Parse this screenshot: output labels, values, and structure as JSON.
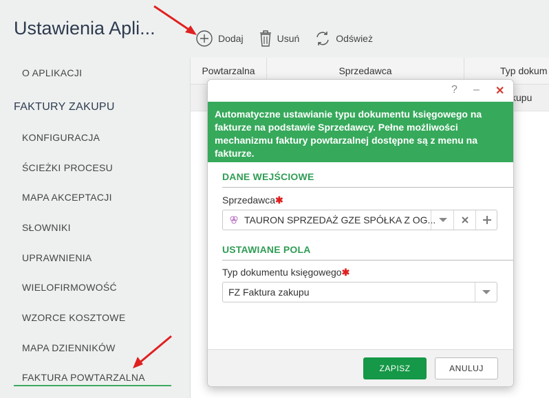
{
  "app": {
    "title": "Ustawienia Apli..."
  },
  "toolbar": {
    "add_label": "Dodaj",
    "delete_label": "Usuń",
    "refresh_label": "Odśwież"
  },
  "sidebar": {
    "about": "O APLIKACJI",
    "section_title": "FAKTURY ZAKUPU",
    "items": [
      {
        "label": "KONFIGURACJA"
      },
      {
        "label": "ŚCIEŻKI PROCESU"
      },
      {
        "label": "MAPA AKCEPTACJI"
      },
      {
        "label": "SŁOWNIKI"
      },
      {
        "label": "UPRAWNIENIA"
      },
      {
        "label": "WIELOFIRMOWOŚĆ"
      },
      {
        "label": "WZORCE KOSZTOWE"
      },
      {
        "label": "MAPA DZIENNIKÓW"
      },
      {
        "label": "FAKTURA POWTARZALNA",
        "active": true
      }
    ]
  },
  "grid": {
    "columns": [
      "Powtarzalna",
      "Sprzedawca",
      "Typ dokum"
    ],
    "row_partial_text": "kupu"
  },
  "dialog": {
    "help_glyph": "?",
    "minimize_glyph": "–",
    "close_glyph": "✕",
    "banner_text": "Automatyczne ustawianie typu dokumentu księgowego na fakturze na podstawie Sprzedawcy. Pełne możliwości mechanizmu faktury powtarzalnej dostępne są z menu na fakturze.",
    "section_input": "DANE WEJŚCIOWE",
    "seller_label": "Sprzedawca",
    "seller_value": "TAURON SPRZEDAŻ GZE SPÓŁKA Z OG...",
    "section_fields": "USTAWIANE POLA",
    "doctype_label": "Typ dokumentu księgowego",
    "doctype_value": "FZ Faktura zakupu",
    "required_mark": "✱",
    "save_label": "ZAPISZ",
    "cancel_label": "ANULUJ"
  },
  "colors": {
    "accent_green": "#36a95b",
    "button_green": "#159847",
    "annotation_red": "#e02020"
  }
}
